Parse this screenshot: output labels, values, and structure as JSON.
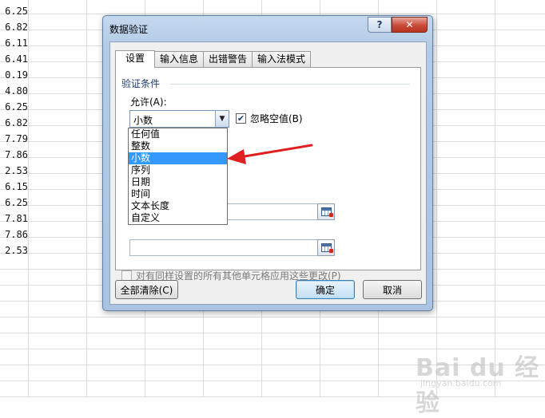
{
  "sheet": {
    "cell_values": [
      "6.25",
      "6.82",
      "6.11",
      "6.41",
      "0.19",
      "4.80",
      "6.25",
      "6.82",
      "7.79",
      "7.86",
      "2.53",
      "6.15",
      "6.25",
      "7.81",
      "7.86",
      "2.53"
    ]
  },
  "dialog": {
    "title": "数据验证",
    "help_label": "?",
    "close_label": "✕",
    "tabs": [
      {
        "label": "设置",
        "active": true
      },
      {
        "label": "输入信息",
        "active": false
      },
      {
        "label": "出错警告",
        "active": false
      },
      {
        "label": "输入法模式",
        "active": false
      }
    ],
    "group_title": "验证条件",
    "allow_label": "允许(A):",
    "allow_value": "小数",
    "ignore_blank_label": "忽略空值(B)",
    "ignore_blank_checked": true,
    "apply_all_label": "对有同样设置的所有其他单元格应用这些更改(P)",
    "apply_all_checked": false,
    "clear_all_label": "全部清除(C)",
    "ok_label": "确定",
    "cancel_label": "取消"
  },
  "dropdown": {
    "items": [
      "任何值",
      "整数",
      "小数",
      "序列",
      "日期",
      "时间",
      "文本长度",
      "自定义"
    ],
    "selected": "小数"
  },
  "annotation": {
    "color": "#e02020"
  },
  "watermark": {
    "line1": "Bai du 经验",
    "line2": "jingyan.baidu.com"
  }
}
